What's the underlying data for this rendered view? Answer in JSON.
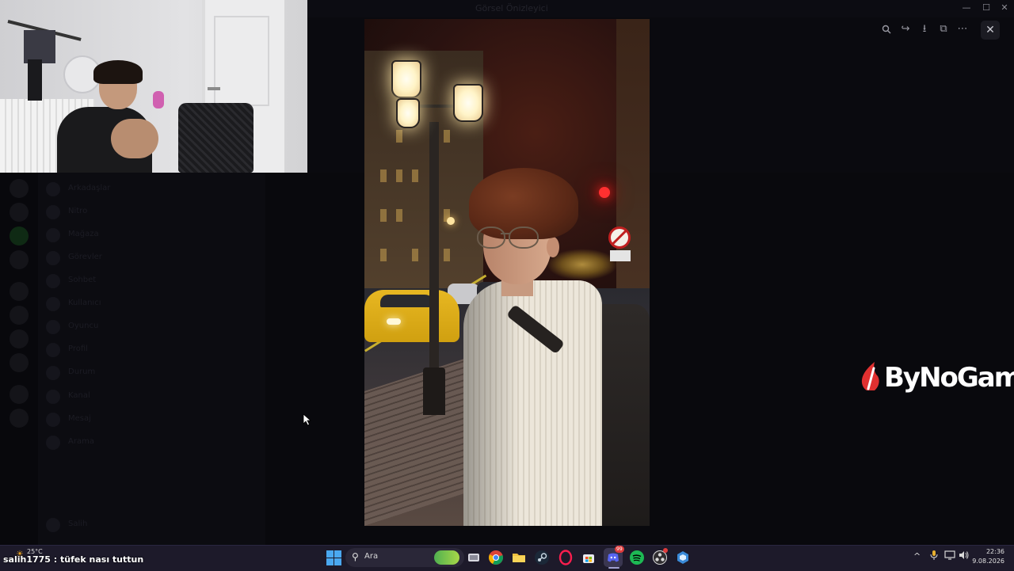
{
  "background_app": {
    "title": "Görsel Önizleyici",
    "channel_items": [
      "Arkadaşlar",
      "Nitro",
      "Mağaza",
      "Görevler",
      "Sohbet",
      "Kullanıcı",
      "Oyuncu",
      "Profil",
      "Durum",
      "Kanal",
      "Mesaj",
      "Arama"
    ],
    "footer_user": "Salih"
  },
  "viewer_toolbar": {
    "zoom_icon": "zoom-in-icon",
    "forward_icon": "forward-icon",
    "download_icon": "download-icon",
    "open_external_icon": "open-external-icon",
    "more_icon": "more-icon",
    "close_icon": "close-icon"
  },
  "window_controls": {
    "minimize": "—",
    "maximize": "☐",
    "close": "✕"
  },
  "logo": {
    "text": "ByNoGame",
    "color": "#ffffff",
    "accent": "#e03030"
  },
  "chat_overlay": {
    "username": "salih1775",
    "separator": " : ",
    "message": "tüfek nası tuttun"
  },
  "taskbar": {
    "weather": "25°C",
    "search_placeholder": "Ara",
    "apps": [
      "file-explorer-icon",
      "chrome-icon",
      "folder-icon",
      "steam-icon",
      "opera-gx-icon",
      "store-icon",
      "discord-icon",
      "spotify-icon",
      "obs-icon",
      "app-icon"
    ],
    "discord_badge": "99",
    "tray": {
      "chevron": "^",
      "mic_icon": "microphone-icon",
      "display_icon": "display-icon",
      "volume_icon": "volume-icon"
    },
    "time": "22:36",
    "date": "9.08.2026"
  },
  "colors": {
    "taskbar_bg": "#1d1a2a",
    "accent_blue": "#4aa8f0",
    "discord": "#5865f2",
    "spotify": "#1db954",
    "chrome_red": "#db4437"
  }
}
